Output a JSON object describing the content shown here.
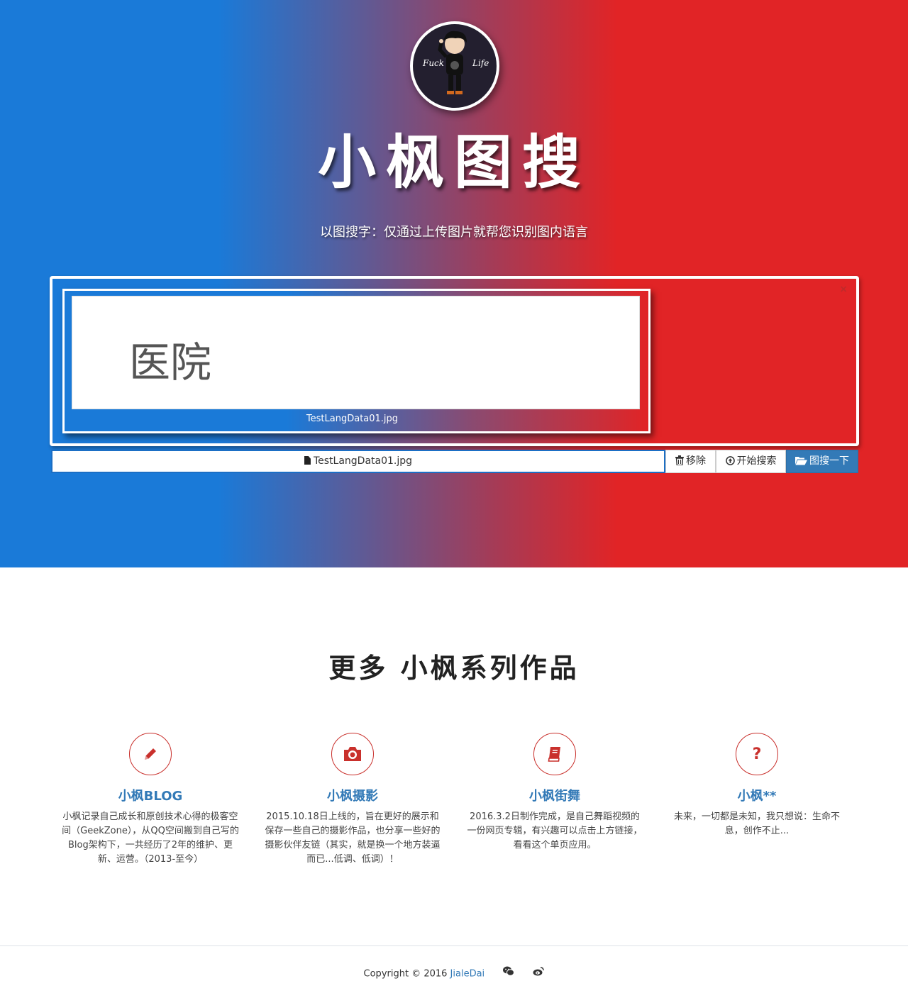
{
  "hero": {
    "avatar_text_left": "Fuck",
    "avatar_text_right": "Life",
    "title": "小枫图搜",
    "subtitle": "以图搜字：仅通过上传图片就帮您识别图内语言"
  },
  "upload": {
    "close_glyph": "×",
    "preview_text": "医院",
    "preview_caption": "TestLangData01.jpg",
    "file_caption": "TestLangData01.jpg",
    "remove_label": "移除",
    "start_label": "开始搜索",
    "search_label": "图搜一下"
  },
  "section": {
    "title": "更多 小枫系列作品",
    "features": [
      {
        "icon": "pencil-icon",
        "title": "小枫BLOG",
        "desc": "小枫记录自己成长和原创技术心得的极客空间（GeekZone），从QQ空间搬到自己写的Blog架构下，一共经历了2年的维护、更新、运营。（2013-至今）"
      },
      {
        "icon": "camera-icon",
        "title": "小枫摄影",
        "desc": "2015.10.18日上线的，旨在更好的展示和保存一些自己的摄影作品，也分享一些好的摄影伙伴友链（其实，就是换一个地方装逼而已...低调、低调）！"
      },
      {
        "icon": "book-icon",
        "title": "小枫街舞",
        "desc": "2016.3.2日制作完成，是自己舞蹈视频的一份网页专辑，有兴趣可以点击上方链接，看看这个单页应用。"
      },
      {
        "icon": "question-icon",
        "title": "小枫**",
        "desc": "未来，一切都是未知，我只想说：生命不息，创作不止..."
      }
    ]
  },
  "footer": {
    "copyright": "Copyright © 2016",
    "author": "JialeDai"
  },
  "colors": {
    "blue": "#1a7ad8",
    "red": "#e12426",
    "link": "#337ab7",
    "icon_red": "#c9302c"
  }
}
